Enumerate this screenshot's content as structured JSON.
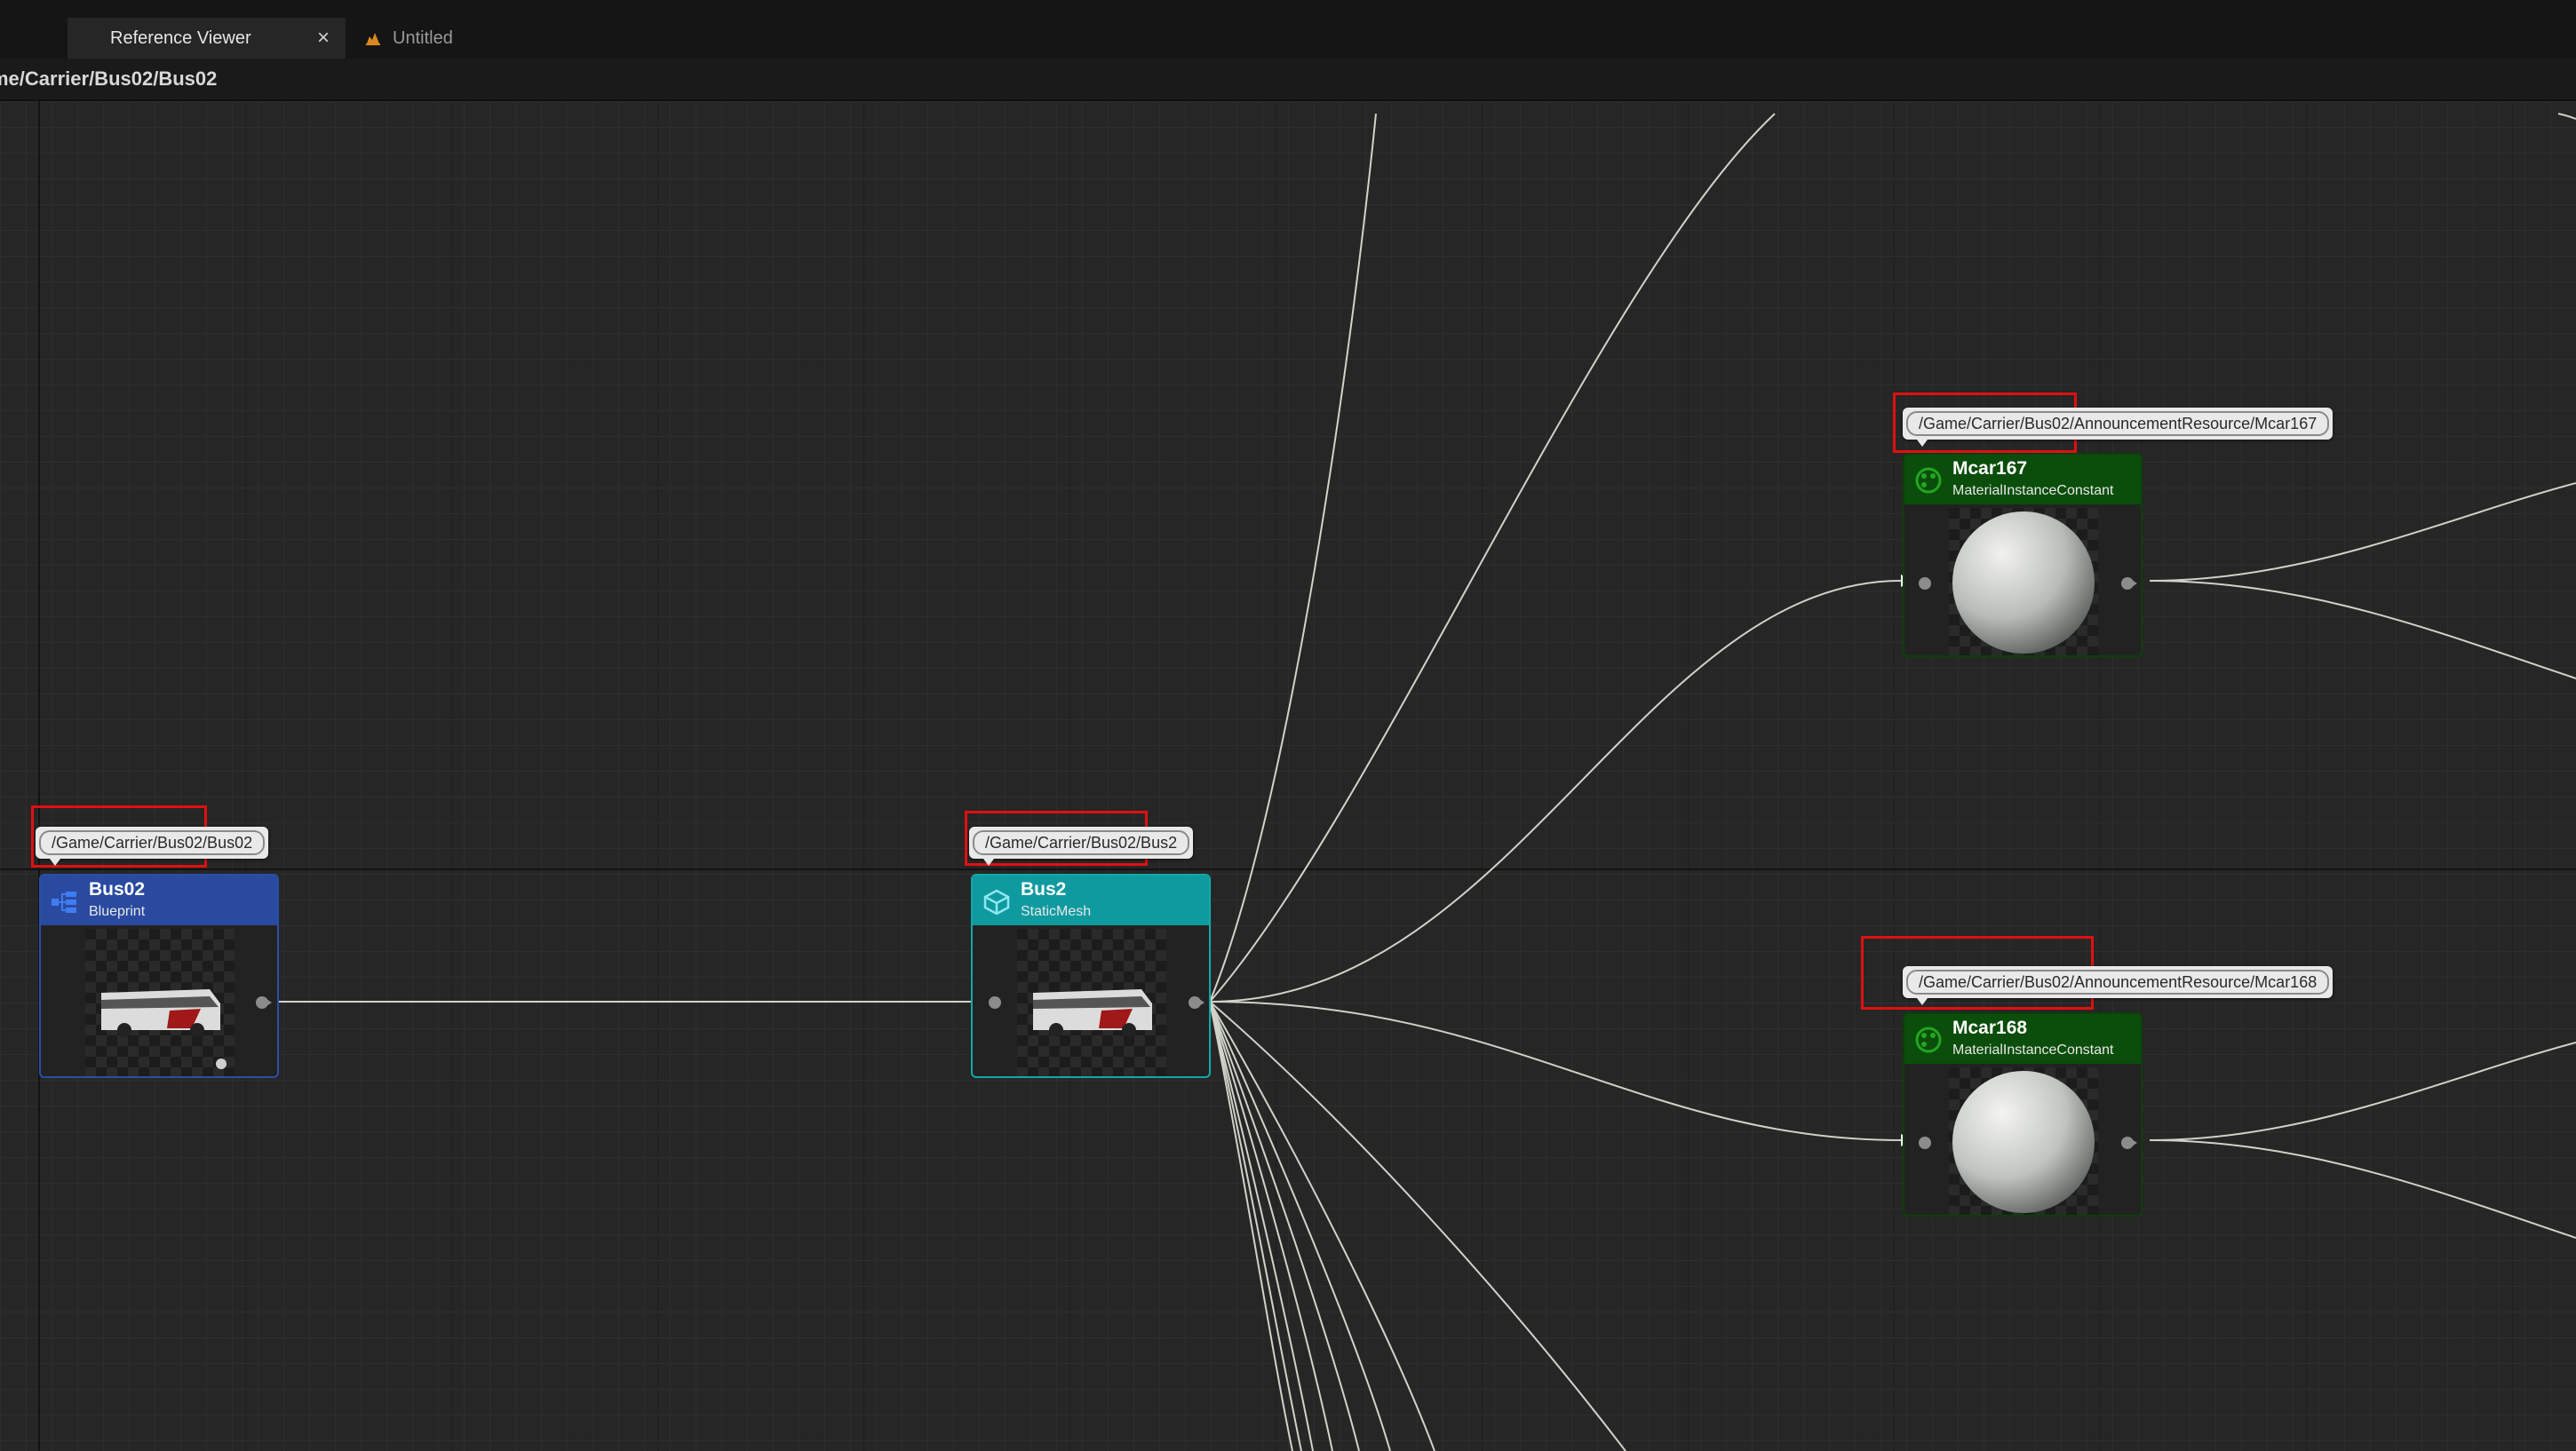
{
  "tabs": [
    {
      "label": "Reference Viewer",
      "active": true,
      "close_glyph": "×"
    },
    {
      "label": "Untitled",
      "active": false,
      "icon": "blueprint-icon"
    }
  ],
  "path_bar": {
    "text": "me/Carrier/Bus02/Bus02"
  },
  "nodes": [
    {
      "path": "/Game/Carrier/Bus02/Bus02",
      "name": "Bus02",
      "type": "Blueprint",
      "icon": "blueprint-class-icon",
      "color": "#2a4aa0"
    },
    {
      "path": "/Game/Carrier/Bus02/Bus2",
      "name": "Bus2",
      "type": "StaticMesh",
      "icon": "static-mesh-icon",
      "color": "#0f9aa0"
    },
    {
      "path": "/Game/Carrier/Bus02/AnnouncementResource/Mcar167",
      "name": "Mcar167",
      "type": "MaterialInstanceConstant",
      "icon": "material-instance-icon",
      "color": "#0b4d0b"
    },
    {
      "path": "/Game/Carrier/Bus02/AnnouncementResource/Mcar168",
      "name": "Mcar168",
      "type": "MaterialInstanceConstant",
      "icon": "material-instance-icon",
      "color": "#0b4d0b"
    }
  ],
  "highlight_color": "#e01010"
}
